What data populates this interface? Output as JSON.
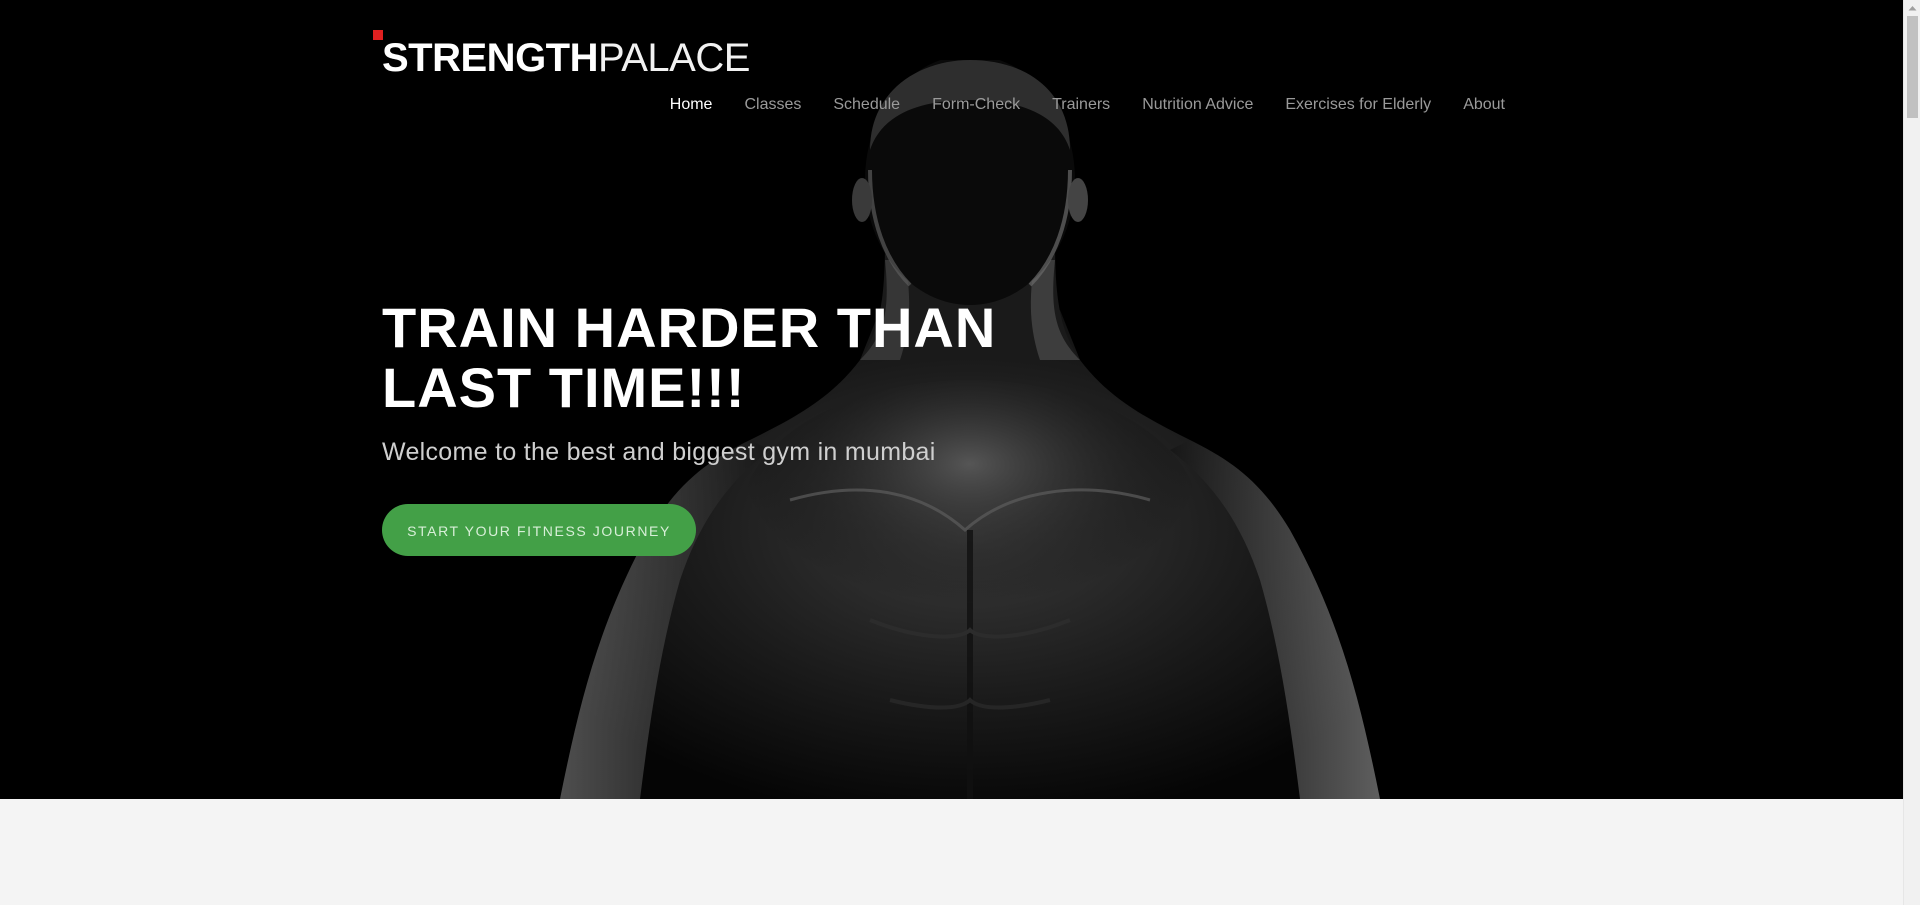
{
  "logo": {
    "bold": "STRENGTH",
    "light": "PALACE",
    "accent_color": "#e02020"
  },
  "nav": {
    "items": [
      {
        "label": "Home",
        "active": true
      },
      {
        "label": "Classes",
        "active": false
      },
      {
        "label": "Schedule",
        "active": false
      },
      {
        "label": "Form-Check",
        "active": false
      },
      {
        "label": "Trainers",
        "active": false
      },
      {
        "label": "Nutrition Advice",
        "active": false
      },
      {
        "label": "Exercises for Elderly",
        "active": false
      },
      {
        "label": "About",
        "active": false
      }
    ]
  },
  "hero": {
    "title": "TRAIN HARDER THAN\nLAST TIME!!!",
    "subtitle": "Welcome to the best and biggest gym in mumbai",
    "cta_label": "START YOUR FITNESS JOURNEY",
    "cta_color": "#43a047",
    "background_color": "#000000",
    "image_icon": "muscular-man-silhouette"
  },
  "page": {
    "below_hero_color": "#f4f4f4"
  }
}
